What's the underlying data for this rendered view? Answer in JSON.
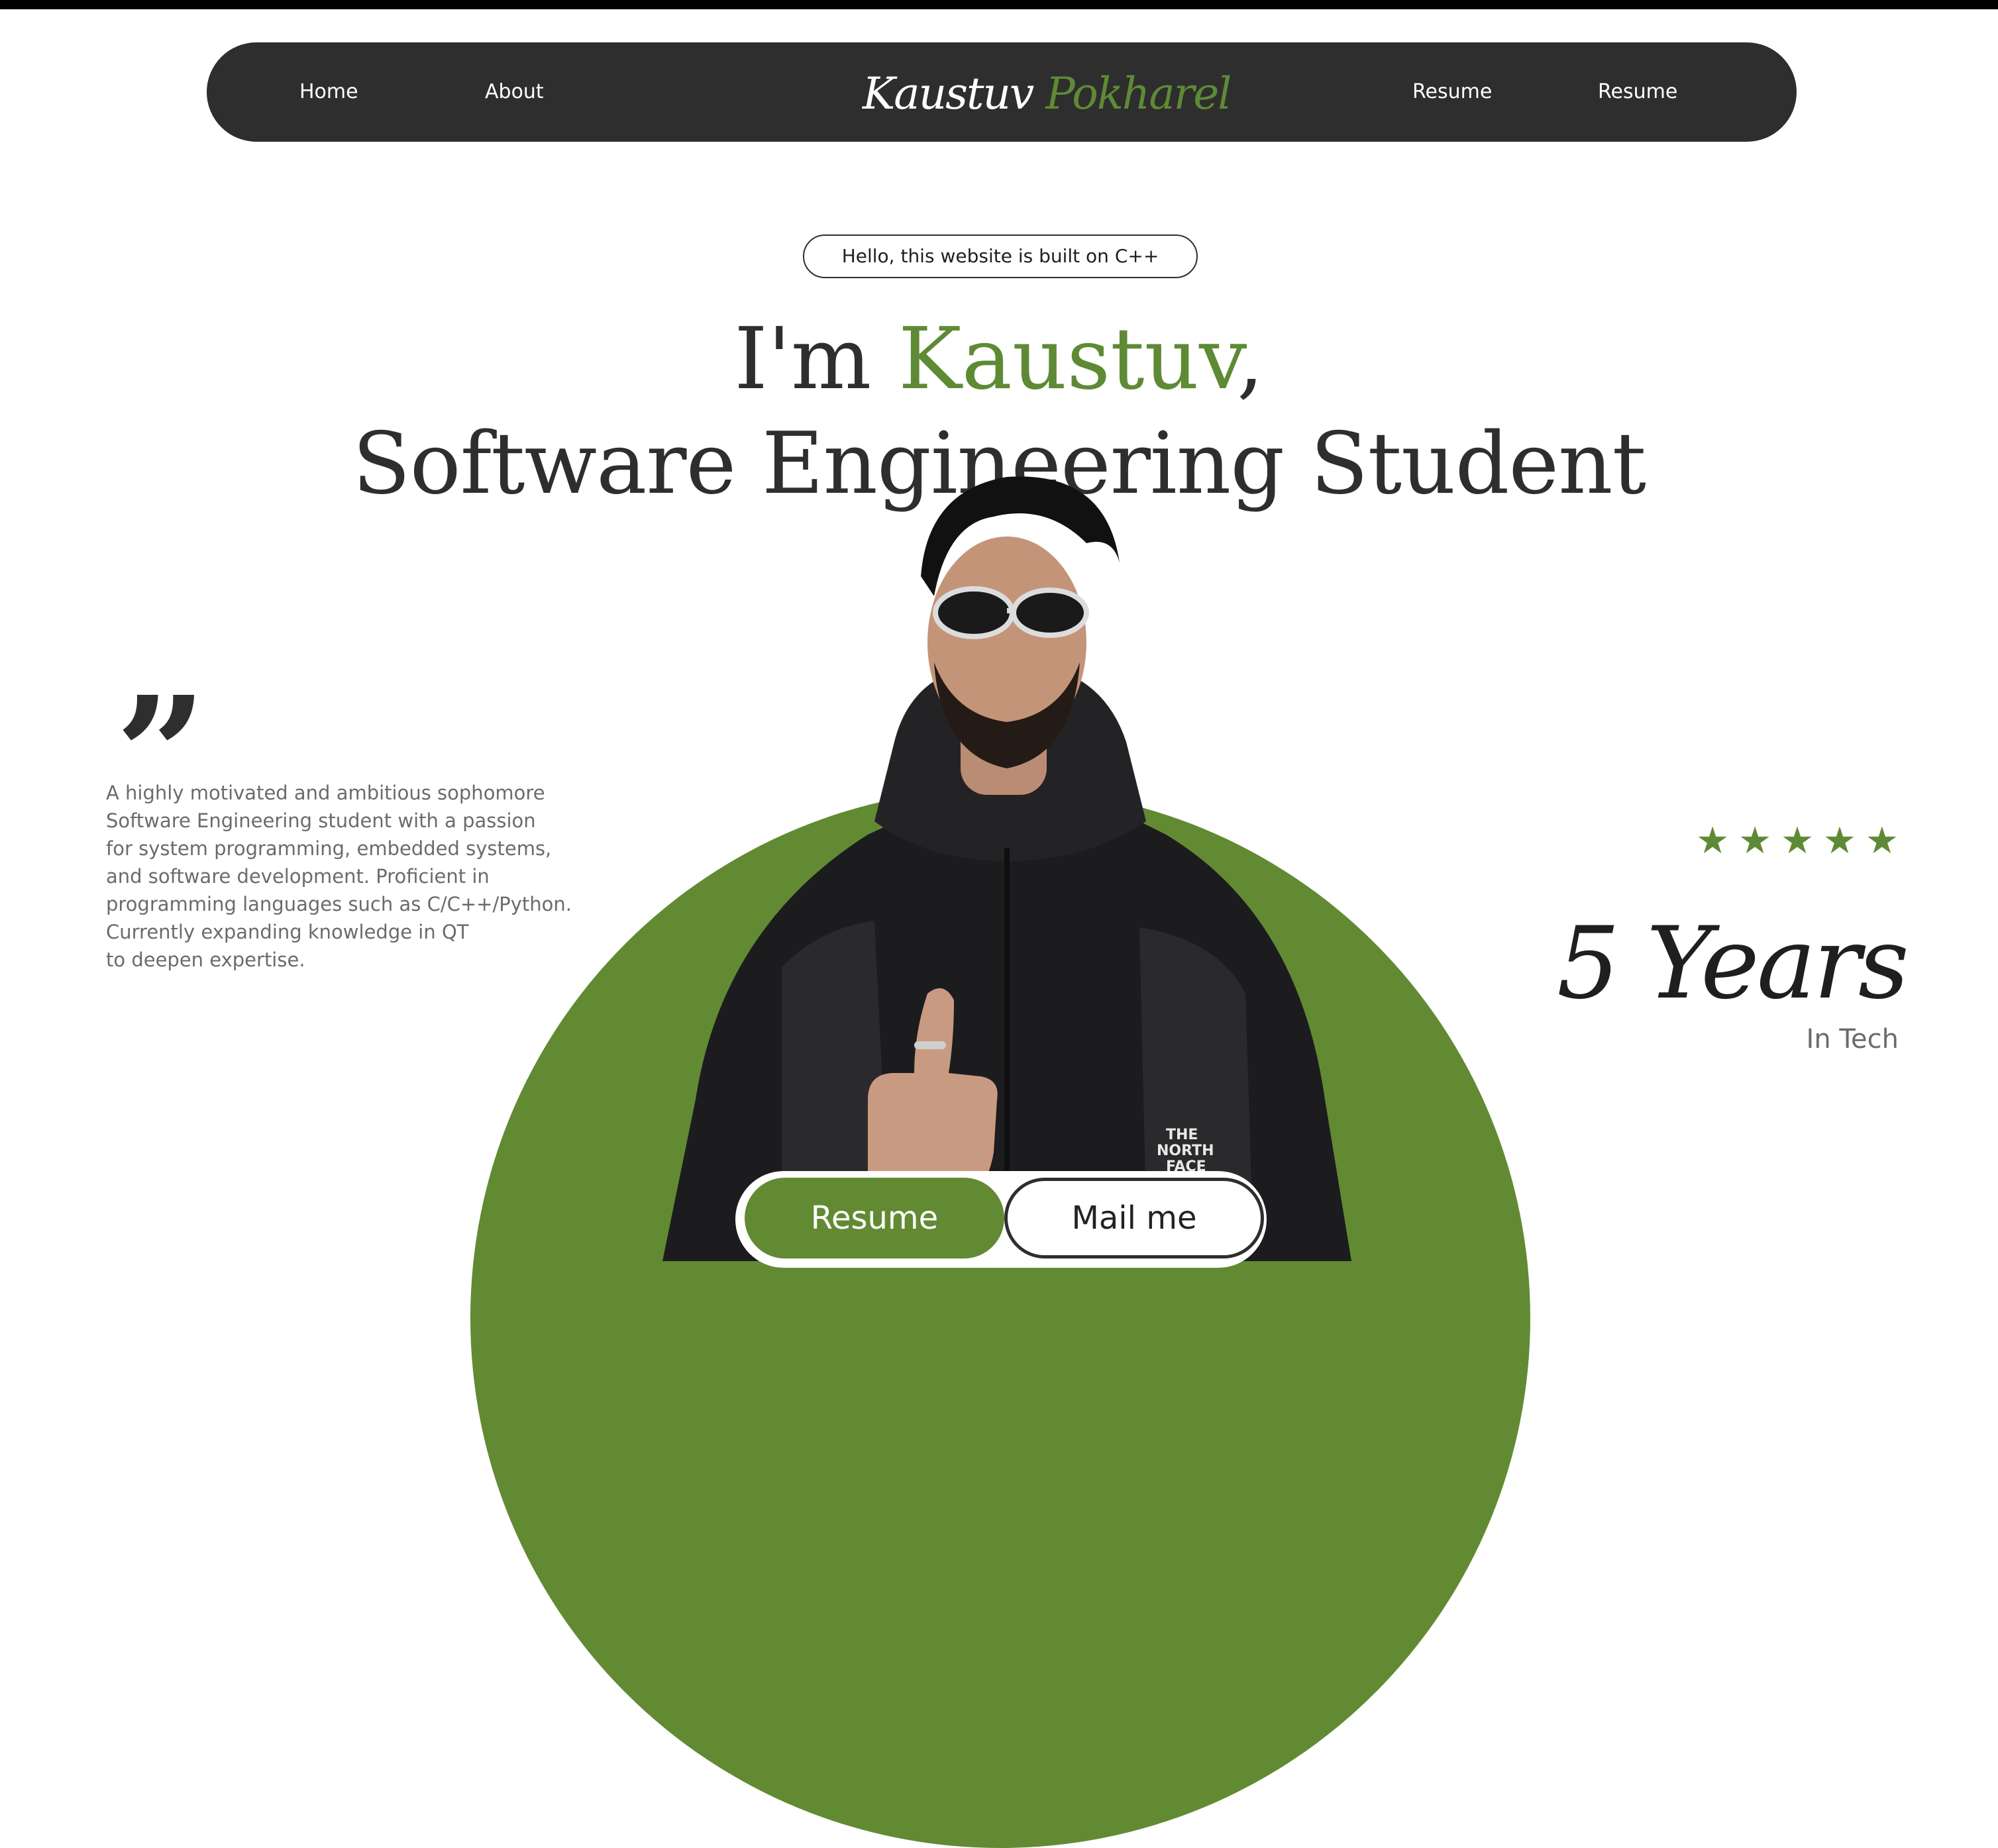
{
  "nav": {
    "links": [
      "Home",
      "About",
      "Resume",
      "Resume"
    ],
    "logo": {
      "first": "Kaustuv",
      "last": "Pokharel"
    }
  },
  "hero": {
    "badge": "Hello, this website is built on C++",
    "greeting_prefix": "I'm",
    "name": "Kaustuv",
    "name_suffix": ",",
    "role": "Software Engineering Student"
  },
  "quote": {
    "mark": "”",
    "lines": [
      "A highly motivated and ambitious sophomore",
      "Software Engineering student with a passion",
      "for system programming, embedded systems,",
      "and software development. Proficient in",
      "programming languages such as C/C++/Python.",
      "Currently expanding knowledge in QT",
      "to deepen expertise."
    ]
  },
  "experience": {
    "rating": 5,
    "star_glyph": "★",
    "years": "5 Years",
    "caption": "In Tech"
  },
  "cta": {
    "resume": "Resume",
    "mail": "Mail me"
  },
  "colors": {
    "accent": "#5e8a35",
    "dark": "#2e2e2e",
    "body_text": "#6b6b6b"
  }
}
